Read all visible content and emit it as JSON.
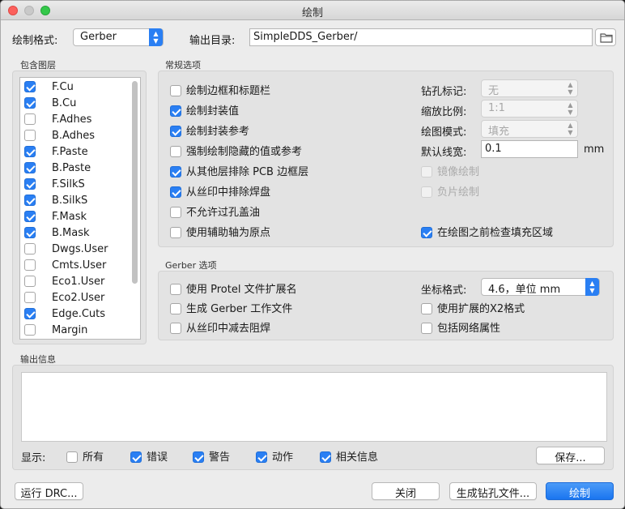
{
  "window": {
    "title": "绘制"
  },
  "top": {
    "format_label": "绘制格式:",
    "format_value": "Gerber",
    "output_dir_label": "输出目录:",
    "output_dir_value": "SimpleDDS_Gerber/"
  },
  "layers": {
    "title": "包含图层",
    "items": [
      {
        "label": "F.Cu",
        "checked": true
      },
      {
        "label": "B.Cu",
        "checked": true
      },
      {
        "label": "F.Adhes",
        "checked": false
      },
      {
        "label": "B.Adhes",
        "checked": false
      },
      {
        "label": "F.Paste",
        "checked": true
      },
      {
        "label": "B.Paste",
        "checked": true
      },
      {
        "label": "F.SilkS",
        "checked": true
      },
      {
        "label": "B.SilkS",
        "checked": true
      },
      {
        "label": "F.Mask",
        "checked": true
      },
      {
        "label": "B.Mask",
        "checked": true
      },
      {
        "label": "Dwgs.User",
        "checked": false
      },
      {
        "label": "Cmts.User",
        "checked": false
      },
      {
        "label": "Eco1.User",
        "checked": false
      },
      {
        "label": "Eco2.User",
        "checked": false
      },
      {
        "label": "Edge.Cuts",
        "checked": true
      },
      {
        "label": "Margin",
        "checked": false
      }
    ]
  },
  "general": {
    "title": "常规选项",
    "left_options": [
      {
        "label": "绘制边框和标题栏",
        "checked": false
      },
      {
        "label": "绘制封装值",
        "checked": true
      },
      {
        "label": "绘制封装参考",
        "checked": true
      },
      {
        "label": "强制绘制隐藏的值或参考",
        "checked": false
      },
      {
        "label": "从其他层排除 PCB 边框层",
        "checked": true
      },
      {
        "label": "从丝印中排除焊盘",
        "checked": true
      },
      {
        "label": "不允许过孔盖油",
        "checked": false
      },
      {
        "label": "使用辅助轴为原点",
        "checked": false
      }
    ],
    "drill_mark_label": "钻孔标记:",
    "drill_mark_value": "无",
    "scale_label": "缩放比例:",
    "scale_value": "1:1",
    "plot_mode_label": "绘图模式:",
    "plot_mode_value": "填充",
    "line_width_label": "默认线宽:",
    "line_width_value": "0.1",
    "line_width_unit": "mm",
    "mirror_label": "镜像绘制",
    "negative_label": "负片绘制",
    "check_zone_label": "在绘图之前检查填充区域",
    "check_zone_checked": true
  },
  "gerber": {
    "title": "Gerber 选项",
    "left_options": [
      {
        "label": "使用 Protel 文件扩展名",
        "checked": false
      },
      {
        "label": "生成 Gerber 工作文件",
        "checked": false
      },
      {
        "label": "从丝印中减去阻焊",
        "checked": false
      }
    ],
    "coord_label": "坐标格式:",
    "coord_value": "4.6，单位 mm",
    "right_options": [
      {
        "label": "使用扩展的X2格式",
        "checked": false
      },
      {
        "label": "包括网络属性",
        "checked": false
      }
    ]
  },
  "output": {
    "title": "输出信息",
    "show_label": "显示:",
    "filters": [
      {
        "label": "所有",
        "checked": false
      },
      {
        "label": "错误",
        "checked": true
      },
      {
        "label": "警告",
        "checked": true
      },
      {
        "label": "动作",
        "checked": true
      },
      {
        "label": "相关信息",
        "checked": true
      }
    ],
    "save_label": "保存..."
  },
  "footer": {
    "drc_label": "运行 DRC...",
    "close_label": "关闭",
    "drill_label": "生成钻孔文件...",
    "plot_label": "绘制"
  },
  "colors": {
    "accent": "#2a7ff3"
  }
}
